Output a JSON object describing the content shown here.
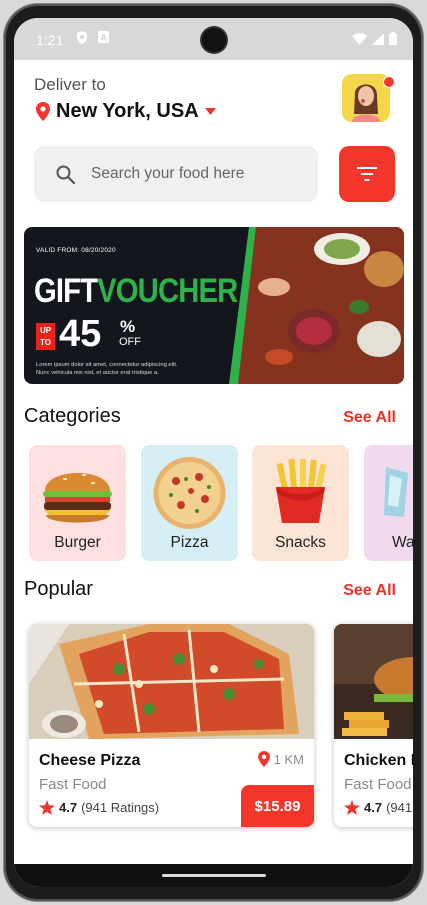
{
  "status": {
    "time": "1:21"
  },
  "header": {
    "deliver_label": "Deliver to",
    "location": "New York, USA"
  },
  "search": {
    "placeholder": "Search your food here"
  },
  "banner": {
    "valid": "VALID FROM: 08/20/2020",
    "title_gift": "GIFT",
    "title_voucher": "VOUCHER",
    "upto_1": "UP",
    "upto_2": "TO",
    "percent": "45",
    "percent_sign": "%",
    "off": "OFF",
    "lorem": "Lorem ipsum dolor sit amet, connectetur adipiscing elit. Nunc vehicula nisi nisl, et auctor erat tristique a."
  },
  "categories": {
    "title": "Categories",
    "see_all": "See All",
    "items": [
      {
        "label": "Burger",
        "bg": "#fde0df"
      },
      {
        "label": "Pizza",
        "bg": "#d6eef5"
      },
      {
        "label": "Snacks",
        "bg": "#fce5d6"
      },
      {
        "label": "Wa",
        "bg": "#f1d9ee"
      }
    ]
  },
  "popular": {
    "title": "Popular",
    "see_all": "See All",
    "items": [
      {
        "name": "Cheese Pizza",
        "category": "Fast Food",
        "rating": "4.7",
        "ratings_count": "(941 Ratings)",
        "distance": "1 KM",
        "price": "$15.89"
      },
      {
        "name": "Chicken B",
        "category": "Fast Food",
        "rating": "4.7",
        "ratings_count": "(941",
        "distance": "",
        "price": ""
      }
    ]
  },
  "colors": {
    "accent": "#f3352b",
    "text": "#111111"
  }
}
